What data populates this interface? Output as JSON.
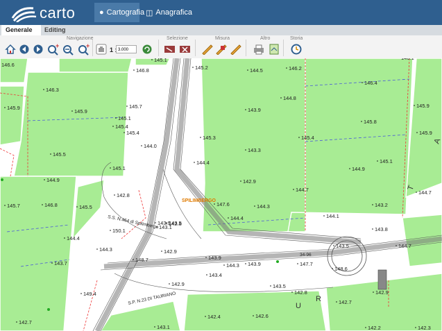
{
  "app": {
    "logo_text": "carto"
  },
  "topnav": [
    {
      "label": "Cartografia",
      "icon": "map-marker-icon",
      "active": true
    },
    {
      "label": "Anagrafica",
      "icon": "database-icon",
      "active": false
    }
  ],
  "tabs": [
    {
      "label": "Generale",
      "active": true
    },
    {
      "label": "Editing",
      "active": false
    }
  ],
  "toolbar": {
    "groups": [
      "Navigazione",
      "Selezione",
      "Misura",
      "Altro",
      "Storia"
    ],
    "scale_prefix": "1 :",
    "scale_value": "3.000"
  },
  "map": {
    "elevations": [
      "146.6",
      "146.3",
      "145.9",
      "146.8",
      "145.1",
      "145.2",
      "144.5",
      "146.2",
      "146.1",
      "146.4",
      "145.9",
      "145.9",
      "145.7",
      "145.4",
      "145.1",
      "143.9",
      "144.8",
      "145.8",
      "145.9",
      "145.5",
      "144.0",
      "145.4",
      "145.3",
      "145.4",
      "144.9",
      "145.1",
      "143.3",
      "144.9",
      "145.1",
      "144.4",
      "144.7",
      "144.7",
      "145.7",
      "146.8",
      "145.5",
      "142.8",
      "142.9",
      "147.6",
      "144.4",
      "143.2",
      "144.1",
      "144.3",
      "143.9",
      "144.4",
      "143.5",
      "143.8",
      "144.7",
      "143.7",
      "144.3",
      "150.1",
      "142.8",
      "143.1",
      "142.9",
      "148.7",
      "143.5",
      "143.9",
      "144.3",
      "143.9",
      "147.7",
      "148.6",
      "143.4",
      "142.9",
      "149.4",
      "142.9",
      "143.5",
      "142.8",
      "142.7",
      "142.7",
      "142.4",
      "142.6",
      "143.1",
      "142.2",
      "142.3"
    ],
    "city_label": "SPILIMBERGO",
    "road_labels": [
      "S.P. N.23 DI TAURIANO",
      "S.S. N.464 di Spilimbergo",
      "34-96"
    ],
    "area_letters": [
      "A",
      "T",
      "U",
      "R"
    ]
  }
}
